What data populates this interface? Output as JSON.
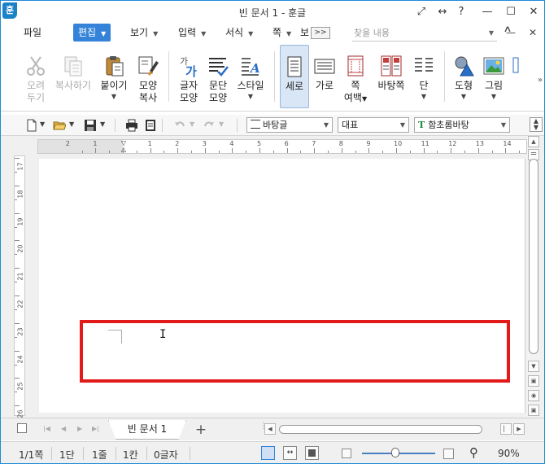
{
  "app": {
    "icon_text": "훈",
    "title": "빈 문서 1 - 훈글"
  },
  "window_controls": [
    "⤢",
    "↔",
    "?",
    "—",
    "☐",
    "✕"
  ],
  "menu": {
    "items": [
      "파일",
      "편집",
      "보기",
      "입력",
      "서식",
      "쪽",
      "보"
    ],
    "active": "편집",
    "more": ">>",
    "search_placeholder": "찾을 내용",
    "right_controls": [
      "—",
      "∧",
      "✕"
    ]
  },
  "ribbon": {
    "buttons": [
      {
        "label": "오려",
        "label2": "두기",
        "icon": "scissors-icon",
        "disabled": true
      },
      {
        "label": "복사하기",
        "label2": "",
        "icon": "copy-icon",
        "disabled": true
      },
      {
        "label": "붙이기",
        "label2": "",
        "icon": "paste-icon",
        "arrow": true
      },
      {
        "label": "모양",
        "label2": "복사",
        "icon": "format-painter-icon"
      },
      {
        "label": "글자",
        "label2": "모양",
        "icon": "char-shape-icon"
      },
      {
        "label": "문단",
        "label2": "모양",
        "icon": "para-shape-icon"
      },
      {
        "label": "스타일",
        "label2": "",
        "icon": "style-icon",
        "arrow": true
      },
      {
        "label": "세로",
        "label2": "",
        "icon": "portrait-page-icon",
        "selected": true
      },
      {
        "label": "가로",
        "label2": "",
        "icon": "landscape-page-icon"
      },
      {
        "label": "쪽",
        "label2": "여백",
        "icon": "page-margin-icon",
        "arrow": true
      },
      {
        "label": "바탕쪽",
        "label2": "",
        "icon": "master-page-icon"
      },
      {
        "label": "단",
        "label2": "",
        "icon": "columns-icon",
        "arrow": true
      },
      {
        "label": "도형",
        "label2": "",
        "icon": "shapes-icon",
        "arrow": true
      },
      {
        "label": "그림",
        "label2": "",
        "icon": "picture-icon",
        "arrow": true
      }
    ],
    "more": "»"
  },
  "toolbar": {
    "style_combo": "바탕글",
    "outline_combo": "대표",
    "font_combo": "함초롬바탕",
    "font_icon": "T"
  },
  "ruler": {
    "h_numbers": [
      "2",
      "1",
      "1",
      "2",
      "3",
      "4",
      "5",
      "6",
      "7",
      "8",
      "9",
      "10",
      "11",
      "12",
      "13",
      "14"
    ],
    "v_numbers": [
      "17",
      "18",
      "19",
      "20",
      "21",
      "22",
      "23",
      "24",
      "25",
      "26"
    ]
  },
  "tabs": {
    "doc_tab": "빈 문서 1",
    "add": "+"
  },
  "status": {
    "page": "1/1쪽",
    "column": "1단",
    "line": "1줄",
    "cell": "1칸",
    "chars": "0글자",
    "zoom": "90%"
  },
  "colors": {
    "accent": "#3583d8",
    "highlight": "#e21a1a",
    "brand": "#1c82c8"
  }
}
